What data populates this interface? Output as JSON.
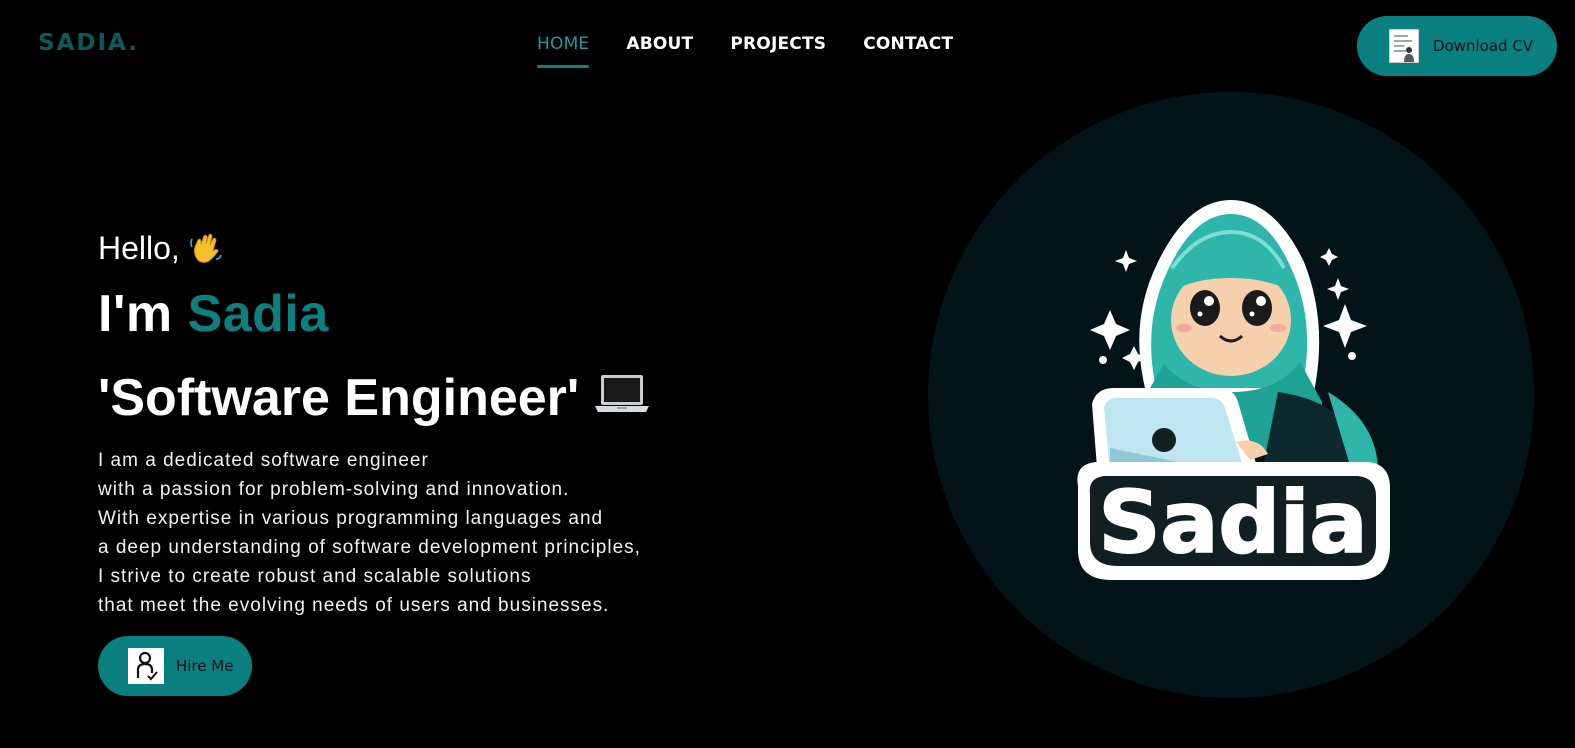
{
  "brand": {
    "logo": "SADIA."
  },
  "nav": {
    "items": [
      {
        "label": "HOME",
        "active": true
      },
      {
        "label": "ABOUT",
        "active": false
      },
      {
        "label": "PROJECTS",
        "active": false
      },
      {
        "label": "CONTACT",
        "active": false
      }
    ]
  },
  "header": {
    "cv_button": "Download CV",
    "cv_icon": "resume-document-icon"
  },
  "hero": {
    "greeting": "Hello,",
    "greeting_emoji": "waving-hand-icon",
    "intro_prefix": "I'm",
    "name": "Sadia",
    "role": "'Software Engineer'",
    "role_emoji": "laptop-icon",
    "description_lines": [
      "I am a dedicated software engineer",
      "with a passion for problem-solving and innovation.",
      "With expertise in various programming languages and",
      "a deep understanding of software development principles,",
      "I strive to create robust and scalable solutions",
      "that meet the evolving needs of users and businesses."
    ],
    "hire_button": "Hire Me",
    "hire_icon": "person-check-icon"
  },
  "avatar": {
    "label": "Sadia",
    "icon": "hijabi-girl-laptop-avatar"
  },
  "colors": {
    "accent": "#0a7f80",
    "accent_text": "#0d7f7f",
    "background": "#000000",
    "circle": "#021418"
  }
}
